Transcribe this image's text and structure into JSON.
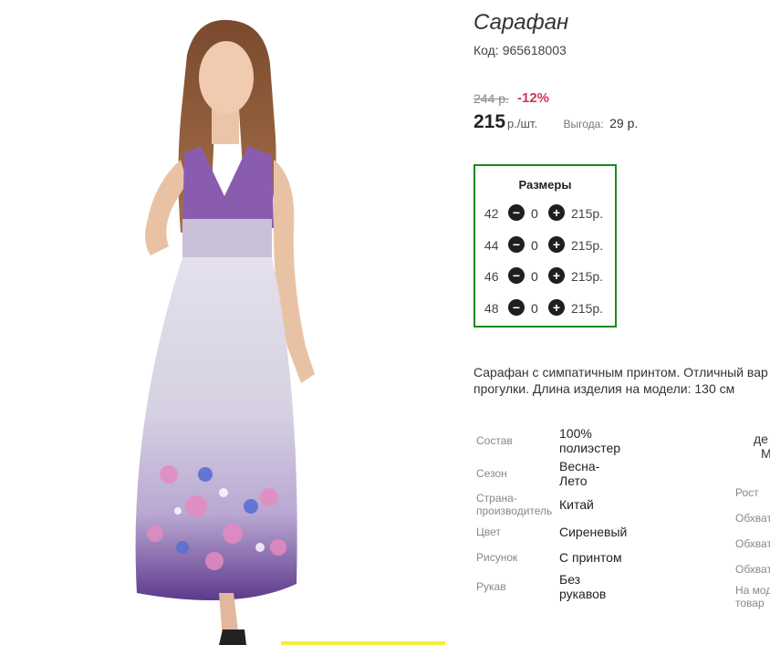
{
  "product": {
    "title": "Сарафан",
    "code_label": "Код:",
    "code": "965618003",
    "old_price": "244 р.",
    "discount": "-12%",
    "price": "215",
    "price_unit": "р./шт.",
    "profit_label": "Выгода:",
    "profit_value": "29 р."
  },
  "sizes": {
    "title": "Размеры",
    "rows": [
      {
        "size": "42",
        "qty": "0",
        "price": "215р."
      },
      {
        "size": "44",
        "qty": "0",
        "price": "215р."
      },
      {
        "size": "46",
        "qty": "0",
        "price": "215р."
      },
      {
        "size": "48",
        "qty": "0",
        "price": "215р."
      }
    ],
    "minus_icon": "−",
    "plus_icon": "+"
  },
  "description": {
    "line1": "Сарафан с симпатичным принтом. Отличный вар",
    "line2": "прогулки. Длина изделия на модели: 130 см"
  },
  "specs": [
    {
      "label": "Состав",
      "value": [
        "100%",
        "полиэстер"
      ]
    },
    {
      "label": "Сезон",
      "value": [
        "Весна-",
        "Лето"
      ]
    },
    {
      "label": [
        "Страна-",
        "производитель"
      ],
      "value": [
        "Китай"
      ]
    },
    {
      "label": "Цвет",
      "value": [
        "Сиреневый"
      ]
    },
    {
      "label": "Рисунок",
      "value": [
        "С принтом"
      ]
    },
    {
      "label": "Рукав",
      "value": [
        "Без",
        "рукавов"
      ]
    }
  ],
  "right_column": {
    "top1": "де",
    "top2": "М",
    "rows": [
      "Рост",
      "Обхват",
      "Обхват",
      "Обхват",
      "На мод",
      "товар"
    ]
  },
  "colors": {
    "accent_green": "#1b8a1b",
    "discount_red": "#d9315a",
    "dress_lilac": "#d8d3e3",
    "print_purple": "#7a3f9a"
  }
}
